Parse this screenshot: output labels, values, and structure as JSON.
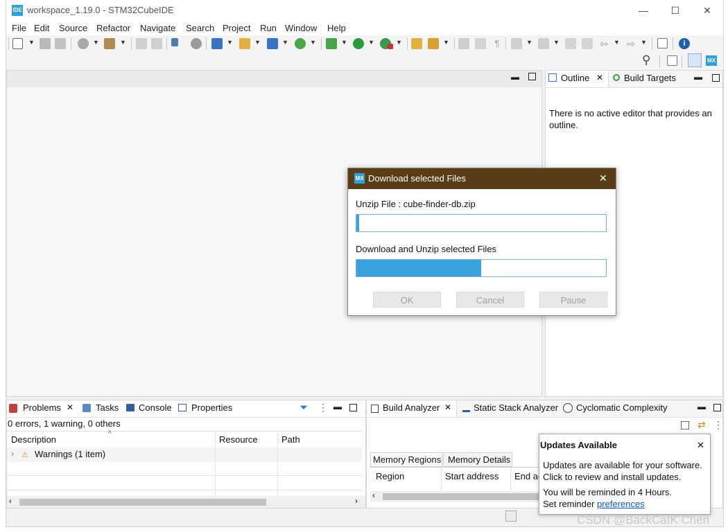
{
  "window": {
    "badge": "IDE",
    "title": "workspace_1.19.0 - STM32CubeIDE",
    "controls": [
      "—",
      "☐",
      "✕"
    ]
  },
  "menu": [
    "File",
    "Edit",
    "Source",
    "Refactor",
    "Navigate",
    "Search",
    "Project",
    "Run",
    "Window",
    "Help"
  ],
  "outline_view": {
    "tabs": [
      "Outline",
      "Build Targets"
    ],
    "message": "There is no active editor that provides an outline."
  },
  "problems_view": {
    "tabs": [
      "Problems",
      "Tasks",
      "Console",
      "Properties"
    ],
    "summary": "0 errors, 1 warning, 0 others",
    "columns": [
      "Description",
      "Resource",
      "Path"
    ],
    "rows": [
      {
        "description": "Warnings (1 item)"
      }
    ]
  },
  "build_analyzer": {
    "tabs": [
      "Build Analyzer",
      "Static Stack Analyzer",
      "Cyclomatic Complexity"
    ],
    "subtabs": [
      "Memory Regions",
      "Memory Details"
    ],
    "columns": [
      "Region",
      "Start address",
      "End ad"
    ]
  },
  "dialog": {
    "badge": "MX",
    "title": "Download selected Files",
    "unzip_label": "Unzip File : cube-finder-db.zip",
    "unzip_progress": 0.01,
    "download_label": "Download and Unzip selected Files",
    "download_progress": 0.5,
    "buttons": {
      "ok": "OK",
      "cancel": "Cancel",
      "pause": "Pause"
    },
    "close": "✕"
  },
  "updates_popup": {
    "title": "Updates Available",
    "line1": "Updates are available for your software.",
    "line2": "Click to review and install updates.",
    "line3": "You will be reminded in 4 Hours.",
    "reminder_prefix": "Set reminder ",
    "reminder_link": "preferences",
    "close": "✕"
  },
  "right_badge": "MX",
  "watermark": "CSDN @BackCatK Chen",
  "colors": {
    "dialog_title": "#5a3c16",
    "progress_fill": "#3aa3dc",
    "accent": "#2fa0d8"
  }
}
